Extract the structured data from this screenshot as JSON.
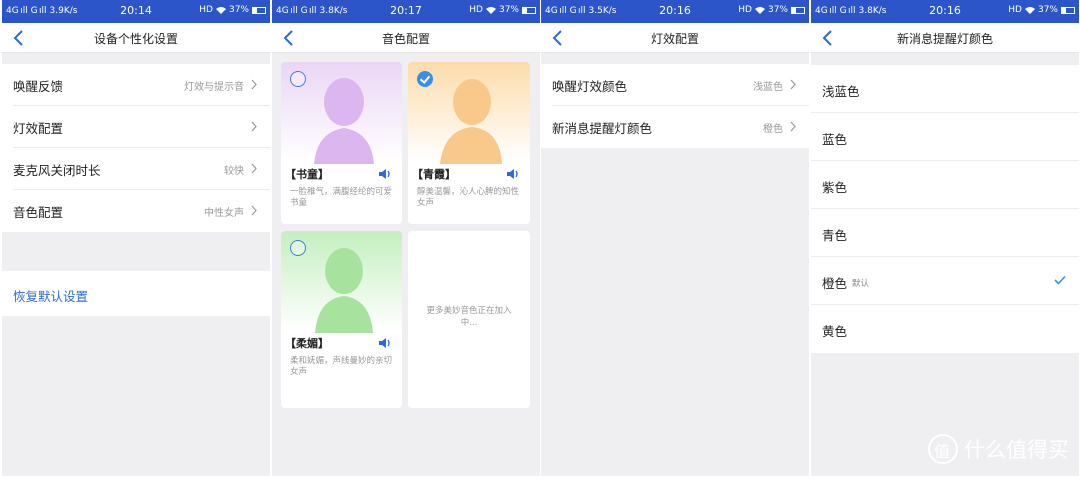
{
  "status": [
    {
      "net": "3.9K/s",
      "time": "20:14",
      "battery": "37%"
    },
    {
      "net": "3.8K/s",
      "time": "20:17",
      "battery": "37%"
    },
    {
      "net": "3.5K/s",
      "time": "20:16",
      "battery": "37%"
    },
    {
      "net": "3.8K/s",
      "time": "20:16",
      "battery": "37%"
    }
  ],
  "status_common": {
    "signal": "4G ıll G ıll",
    "hd": "HD"
  },
  "screen1": {
    "title": "设备个性化设置",
    "rows": [
      {
        "label": "唤醒反馈",
        "value": "灯效与提示音"
      },
      {
        "label": "灯效配置",
        "value": ""
      },
      {
        "label": "麦克风关闭时长",
        "value": "较快"
      },
      {
        "label": "音色配置",
        "value": "中性女声"
      }
    ],
    "reset": "恢复默认设置"
  },
  "screen2": {
    "title": "音色配置",
    "cards": [
      {
        "name": "【书童】",
        "desc": "一脸稚气，满腹经纶的可爱书童",
        "selected": false,
        "color": "#e2c7f3"
      },
      {
        "name": "【青霞】",
        "desc": "醇美温馨，沁人心脾的知性女声",
        "selected": true,
        "color": "#fbd9a6"
      },
      {
        "name": "【柔媚】",
        "desc": "柔和妩媚，声线曼妙的亲切女声",
        "selected": false,
        "color": "#bdeab9"
      }
    ],
    "more": "更多美妙音色正在加入中..."
  },
  "screen3": {
    "title": "灯效配置",
    "rows": [
      {
        "label": "唤醒灯效颜色",
        "value": "浅蓝色"
      },
      {
        "label": "新消息提醒灯颜色",
        "value": "橙色"
      }
    ]
  },
  "screen4": {
    "title": "新消息提醒灯颜色",
    "colors": [
      {
        "label": "浅蓝色",
        "default": "",
        "checked": false
      },
      {
        "label": "蓝色",
        "default": "",
        "checked": false
      },
      {
        "label": "紫色",
        "default": "",
        "checked": false
      },
      {
        "label": "青色",
        "default": "",
        "checked": false
      },
      {
        "label": "橙色",
        "default": "默认",
        "checked": true
      },
      {
        "label": "黄色",
        "default": "",
        "checked": false
      }
    ]
  },
  "watermark": "什么值得买",
  "colors": {
    "statusbar": "#2c55c9",
    "accent": "#2c6bd8",
    "check": "#3a8eea"
  }
}
